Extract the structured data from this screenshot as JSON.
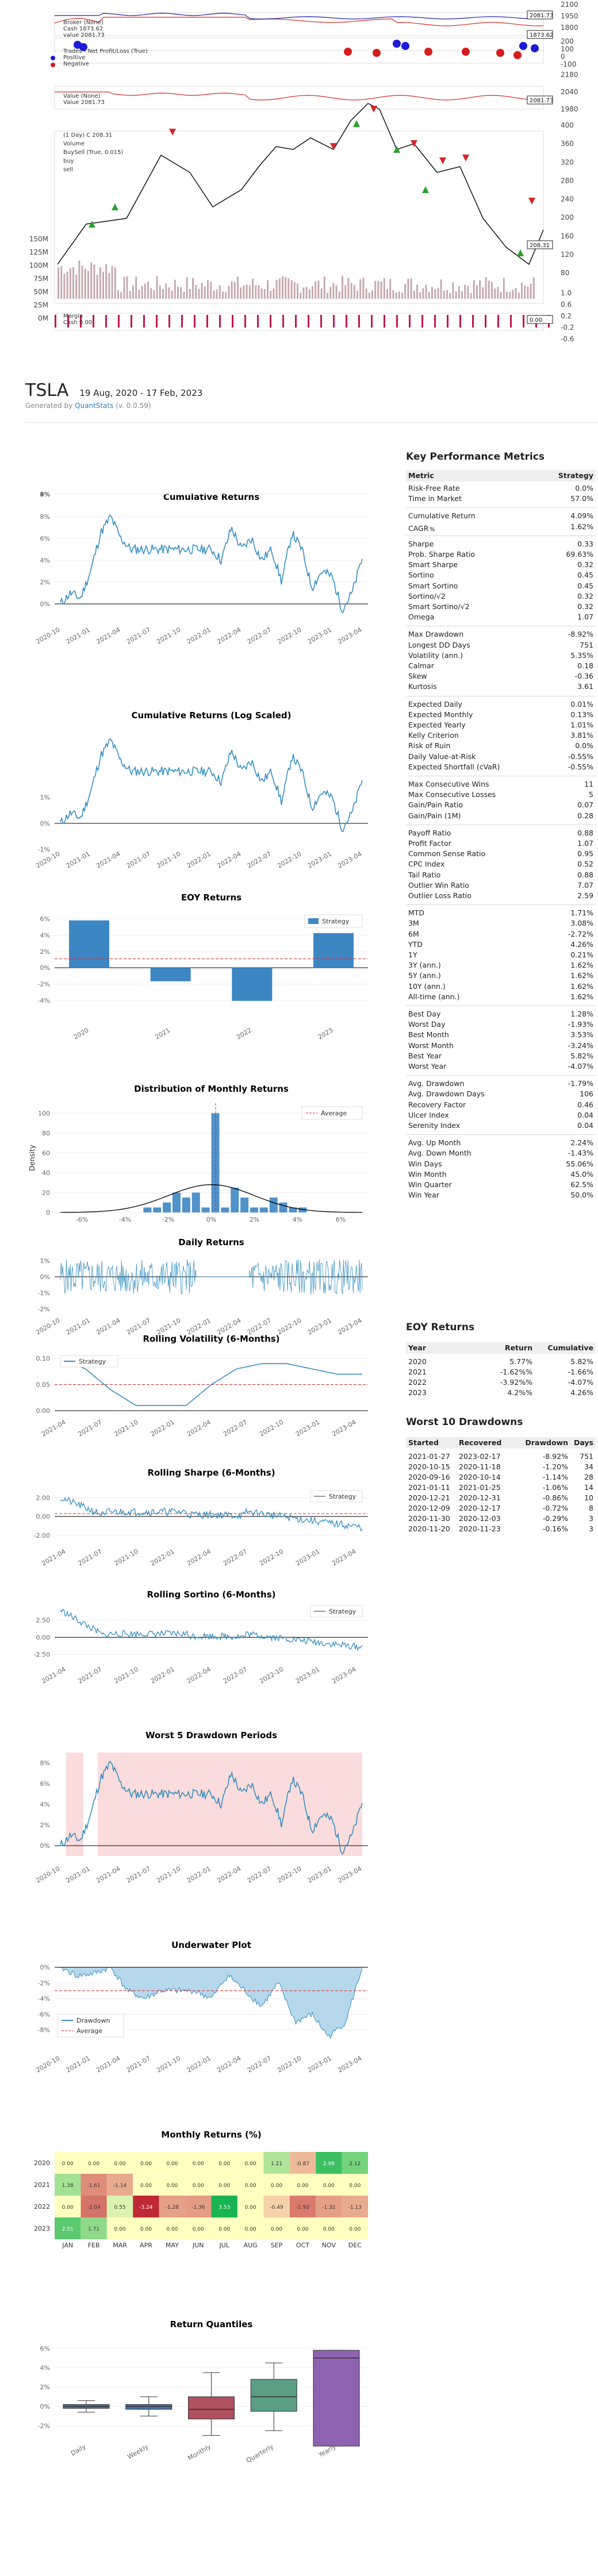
{
  "header": {
    "title": "TSLA",
    "period": "19 Aug, 2020 - 17 Feb, 2023",
    "generated_prefix": "Generated by ",
    "generated_link": "QuantStats",
    "generated_version": " (v. 0.0.59)"
  },
  "top_panel": {
    "legend_broker": [
      "Broker (None)",
      "Cash 1873.62",
      "value 2081.73"
    ],
    "legend_trades": [
      "Trades - Net Profit/Loss (True)",
      "Positive",
      "Negative"
    ],
    "legend_value": [
      "Value (None)",
      "Value 2081.73"
    ],
    "legend_price": [
      "(1 Day) C 208.31",
      "Volume",
      "BuySell (True, 0.015)",
      "buy",
      "sell"
    ],
    "legend_margin": [
      "Margin",
      "Cash 0.00"
    ],
    "badges": [
      "2081.73",
      "1873.62",
      "2081.73",
      "208.31",
      "0.00"
    ],
    "right_ticks_broker": [
      "2100",
      "1950",
      "1800"
    ],
    "right_ticks_trades": [
      "200",
      "100",
      "0",
      "-100"
    ],
    "right_ticks_value": [
      "2180",
      "2040",
      "1980"
    ],
    "right_ticks_price": [
      "400",
      "360",
      "320",
      "280",
      "240",
      "200",
      "160",
      "120",
      "80"
    ],
    "left_ticks_volume": [
      "150M",
      "125M",
      "100M",
      "75M",
      "50M",
      "25M",
      "0M"
    ],
    "right_ticks_margin": [
      "1.0",
      "0.6",
      "0.2",
      "-0.2",
      "-0.6"
    ]
  },
  "kpi": {
    "title": "Key Performance Metrics",
    "col_metric": "Metric",
    "col_strategy": "Strategy",
    "groups": [
      [
        [
          "Risk-Free Rate",
          "0.0%"
        ],
        [
          "Time in Market",
          "57.0%"
        ]
      ],
      [
        [
          "Cumulative Return",
          "4.09%"
        ],
        [
          "CAGR﹪",
          "1.62%"
        ]
      ],
      [
        [
          "Sharpe",
          "0.33"
        ],
        [
          "Prob. Sharpe Ratio",
          "69.63%"
        ],
        [
          "Smart Sharpe",
          "0.32"
        ],
        [
          "Sortino",
          "0.45"
        ],
        [
          "Smart Sortino",
          "0.45"
        ],
        [
          "Sortino/√2",
          "0.32"
        ],
        [
          "Smart Sortino/√2",
          "0.32"
        ],
        [
          "Omega",
          "1.07"
        ]
      ],
      [
        [
          "Max Drawdown",
          "-8.92%"
        ],
        [
          "Longest DD Days",
          "751"
        ],
        [
          "Volatility (ann.)",
          "5.35%"
        ],
        [
          "Calmar",
          "0.18"
        ],
        [
          "Skew",
          "-0.36"
        ],
        [
          "Kurtosis",
          "3.61"
        ]
      ],
      [
        [
          "Expected Daily",
          "0.01%"
        ],
        [
          "Expected Monthly",
          "0.13%"
        ],
        [
          "Expected Yearly",
          "1.01%"
        ],
        [
          "Kelly Criterion",
          "3.81%"
        ],
        [
          "Risk of Ruin",
          "0.0%"
        ],
        [
          "Daily Value-at-Risk",
          "-0.55%"
        ],
        [
          "Expected Shortfall (cVaR)",
          "-0.55%"
        ]
      ],
      [
        [
          "Max Consecutive Wins",
          "11"
        ],
        [
          "Max Consecutive Losses",
          "5"
        ],
        [
          "Gain/Pain Ratio",
          "0.07"
        ],
        [
          "Gain/Pain (1M)",
          "0.28"
        ]
      ],
      [
        [
          "Payoff Ratio",
          "0.88"
        ],
        [
          "Profit Factor",
          "1.07"
        ],
        [
          "Common Sense Ratio",
          "0.95"
        ],
        [
          "CPC Index",
          "0.52"
        ],
        [
          "Tail Ratio",
          "0.88"
        ],
        [
          "Outlier Win Ratio",
          "7.07"
        ],
        [
          "Outlier Loss Ratio",
          "2.59"
        ]
      ],
      [
        [
          "MTD",
          "1.71%"
        ],
        [
          "3M",
          "3.08%"
        ],
        [
          "6M",
          "-2.72%"
        ],
        [
          "YTD",
          "4.26%"
        ],
        [
          "1Y",
          "0.21%"
        ],
        [
          "3Y (ann.)",
          "1.62%"
        ],
        [
          "5Y (ann.)",
          "1.62%"
        ],
        [
          "10Y (ann.)",
          "1.62%"
        ],
        [
          "All-time (ann.)",
          "1.62%"
        ]
      ],
      [
        [
          "Best Day",
          "1.28%"
        ],
        [
          "Worst Day",
          "-1.93%"
        ],
        [
          "Best Month",
          "3.53%"
        ],
        [
          "Worst Month",
          "-3.24%"
        ],
        [
          "Best Year",
          "5.82%"
        ],
        [
          "Worst Year",
          "-4.07%"
        ]
      ],
      [
        [
          "Avg. Drawdown",
          "-1.79%"
        ],
        [
          "Avg. Drawdown Days",
          "106"
        ],
        [
          "Recovery Factor",
          "0.46"
        ],
        [
          "Ulcer Index",
          "0.04"
        ],
        [
          "Serenity Index",
          "0.04"
        ]
      ],
      [
        [
          "Avg. Up Month",
          "2.24%"
        ],
        [
          "Avg. Down Month",
          "-1.43%"
        ],
        [
          "Win Days",
          "55.06%"
        ],
        [
          "Win Month",
          "45.0%"
        ],
        [
          "Win Quarter",
          "62.5%"
        ],
        [
          "Win Year",
          "50.0%"
        ]
      ]
    ]
  },
  "eoy_table": {
    "title": "EOY Returns",
    "headers": [
      "Year",
      "Return",
      "Cumulative"
    ],
    "rows": [
      [
        "2020",
        "5.77%",
        "5.82%"
      ],
      [
        "2021",
        "-1.62%%",
        "-1.66%"
      ],
      [
        "2022",
        "-3.92%%",
        "-4.07%"
      ],
      [
        "2023",
        "4.2%%",
        "4.26%"
      ]
    ]
  },
  "dd_table": {
    "title": "Worst 10 Drawdowns",
    "headers": [
      "Started",
      "Recovered",
      "Drawdown",
      "Days"
    ],
    "rows": [
      [
        "2021-01-27",
        "2023-02-17",
        "-8.92%",
        "751"
      ],
      [
        "2020-10-15",
        "2020-11-18",
        "-1.20%",
        "34"
      ],
      [
        "2020-09-16",
        "2020-10-14",
        "-1.14%",
        "28"
      ],
      [
        "2021-01-11",
        "2021-01-25",
        "-1.06%",
        "14"
      ],
      [
        "2020-12-21",
        "2020-12-31",
        "-0.86%",
        "10"
      ],
      [
        "2020-12-09",
        "2020-12-17",
        "-0.72%",
        "8"
      ],
      [
        "2020-11-30",
        "2020-12-03",
        "-0.29%",
        "3"
      ],
      [
        "2020-11-20",
        "2020-11-23",
        "-0.16%",
        "3"
      ]
    ]
  },
  "chart_data": [
    {
      "type": "line",
      "title": "Cumulative Returns",
      "x": [
        "2020-08",
        "2020-09",
        "2020-10",
        "2020-11",
        "2020-12",
        "2021-01",
        "2021-02",
        "2021-03",
        "2021-04",
        "2021-05",
        "2021-06",
        "2021-07",
        "2021-08",
        "2021-09",
        "2021-10",
        "2021-11",
        "2021-12",
        "2022-01",
        "2022-02",
        "2022-03",
        "2022-04",
        "2022-05",
        "2022-06",
        "2022-07",
        "2022-08",
        "2022-09",
        "2022-10",
        "2022-11",
        "2022-12",
        "2023-01",
        "2023-02"
      ],
      "values": [
        0.0,
        1.0,
        0.5,
        3.0,
        6.5,
        8.0,
        6.0,
        5.0,
        5.0,
        5.0,
        5.0,
        5.0,
        5.0,
        5.0,
        5.0,
        5.0,
        4.0,
        7.0,
        5.0,
        6.0,
        4.0,
        5.0,
        2.0,
        6.5,
        5.0,
        1.5,
        3.0,
        2.5,
        -0.5,
        1.0,
        4.2
      ],
      "ylim": [
        -1,
        9
      ],
      "yticks": [
        "0%",
        "2%",
        "4%",
        "6%",
        "8%"
      ],
      "xticks": [
        "2020-10",
        "2021-01",
        "2021-04",
        "2021-07",
        "2021-10",
        "2022-01",
        "2022-04",
        "2022-07",
        "2022-10",
        "2023-01",
        "2023-04"
      ]
    },
    {
      "type": "line",
      "title": "Cumulative Returns (Log Scaled)",
      "x": [
        "2020-08",
        "2020-09",
        "2020-10",
        "2020-11",
        "2020-12",
        "2021-01",
        "2021-02",
        "2021-03",
        "2021-04",
        "2021-05",
        "2021-06",
        "2021-07",
        "2021-08",
        "2021-09",
        "2021-10",
        "2021-11",
        "2021-12",
        "2022-01",
        "2022-02",
        "2022-03",
        "2022-04",
        "2022-05",
        "2022-06",
        "2022-07",
        "2022-08",
        "2022-09",
        "2022-10",
        "2022-11",
        "2022-12",
        "2023-01",
        "2023-02"
      ],
      "values": [
        0.0,
        1.0,
        0.5,
        3.0,
        6.5,
        8.0,
        6.0,
        5.0,
        5.0,
        5.0,
        5.0,
        5.0,
        5.0,
        5.0,
        5.0,
        5.0,
        4.0,
        7.0,
        5.0,
        6.0,
        4.0,
        5.0,
        2.0,
        6.5,
        5.0,
        1.5,
        3.0,
        2.5,
        -0.5,
        1.0,
        4.2
      ],
      "ylim": [
        -1.5,
        9
      ],
      "yticks": [
        "-1%",
        "0%",
        "1%"
      ],
      "xticks": [
        "2020-10",
        "2021-01",
        "2021-04",
        "2021-07",
        "2021-10",
        "2022-01",
        "2022-04",
        "2022-07",
        "2022-10",
        "2023-01",
        "2023-04"
      ]
    },
    {
      "type": "bar",
      "title": "EOY Returns",
      "categories": [
        "2020",
        "2021",
        "2022",
        "2023"
      ],
      "values": [
        5.82,
        -1.66,
        -4.07,
        4.26
      ],
      "average": 1.1,
      "legend": "Strategy",
      "ylim": [
        -5,
        7
      ],
      "yticks": [
        "6%",
        "4%",
        "2%",
        "0%",
        "-2%",
        "-4%"
      ]
    },
    {
      "type": "bar",
      "title": "Distribution of Monthly Returns",
      "legend": "Average",
      "ylabel": "Density",
      "bins": [
        -2.1,
        -1.8,
        -1.5,
        -1.2,
        -0.9,
        -0.6,
        -0.3,
        0.0,
        0.3,
        0.6,
        0.9,
        1.2,
        1.5,
        1.8,
        2.1,
        2.4,
        2.7
      ],
      "values": [
        5,
        5,
        10,
        20,
        15,
        20,
        5,
        100,
        5,
        25,
        15,
        5,
        5,
        15,
        10,
        5,
        5
      ],
      "ylim": [
        0,
        110
      ],
      "yticks": [
        "0",
        "20",
        "40",
        "60",
        "80",
        "100"
      ],
      "xticks": [
        "-6%",
        "-4%",
        "-2%",
        "0%",
        "2%",
        "4%",
        "6%"
      ]
    },
    {
      "type": "line",
      "title": "Daily Returns",
      "ylim": [
        -2,
        1.5
      ],
      "yticks": [
        "1%",
        "0%",
        "-1%",
        "-2%"
      ],
      "xticks": [
        "2020-10",
        "2021-01",
        "2021-04",
        "2021-07",
        "2021-10",
        "2022-01",
        "2022-04",
        "2022-07",
        "2022-10",
        "2023-01",
        "2023-04"
      ]
    },
    {
      "type": "line",
      "title": "Rolling Volatility (6-Months)",
      "legend": "Strategy",
      "x": [
        "2021-02",
        "2021-04",
        "2021-06",
        "2021-08",
        "2021-10",
        "2021-12",
        "2022-02",
        "2022-04",
        "2022-06",
        "2022-08",
        "2022-10",
        "2022-12",
        "2023-02"
      ],
      "values": [
        0.1,
        0.08,
        0.04,
        0.01,
        0.01,
        0.01,
        0.05,
        0.08,
        0.09,
        0.09,
        0.08,
        0.07,
        0.07
      ],
      "average": 0.05,
      "ylim": [
        0,
        0.11
      ],
      "yticks": [
        "0.10",
        "0.05",
        "0.00"
      ],
      "xticks": [
        "2021-04",
        "2021-07",
        "2021-10",
        "2022-01",
        "2022-04",
        "2022-07",
        "2022-10",
        "2023-01",
        "2023-04"
      ]
    },
    {
      "type": "line",
      "title": "Rolling Sharpe (6-Months)",
      "legend": "Strategy",
      "ylim": [
        -2.5,
        3
      ],
      "yticks": [
        "2.00",
        "0.00",
        "-2.00"
      ],
      "xticks": [
        "2021-04",
        "2021-07",
        "2021-10",
        "2022-01",
        "2022-04",
        "2022-07",
        "2022-10",
        "2023-01",
        "2023-04"
      ]
    },
    {
      "type": "line",
      "title": "Rolling Sortino (6-Months)",
      "legend": "Strategy",
      "ylim": [
        -3,
        5
      ],
      "yticks": [
        "2.50",
        "0.00",
        "-2.50"
      ],
      "xticks": [
        "2021-04",
        "2021-07",
        "2021-10",
        "2022-01",
        "2022-04",
        "2022-07",
        "2022-10",
        "2023-01",
        "2023-04"
      ]
    },
    {
      "type": "line",
      "title": "Worst 5 Drawdown Periods",
      "x": [
        "2020-08",
        "2020-09",
        "2020-10",
        "2020-11",
        "2020-12",
        "2021-01",
        "2021-02",
        "2021-03",
        "2021-04",
        "2021-05",
        "2021-06",
        "2021-07",
        "2021-08",
        "2021-09",
        "2021-10",
        "2021-11",
        "2021-12",
        "2022-01",
        "2022-02",
        "2022-03",
        "2022-04",
        "2022-05",
        "2022-06",
        "2022-07",
        "2022-08",
        "2022-09",
        "2022-10",
        "2022-11",
        "2022-12",
        "2023-01",
        "2023-02"
      ],
      "values": [
        0.0,
        1.0,
        0.5,
        3.0,
        6.5,
        8.0,
        6.0,
        5.0,
        5.0,
        5.0,
        5.0,
        5.0,
        5.0,
        5.0,
        5.0,
        5.0,
        4.0,
        7.0,
        5.0,
        6.0,
        4.0,
        5.0,
        2.0,
        6.5,
        5.0,
        1.5,
        3.0,
        2.5,
        -0.5,
        1.0,
        4.2
      ],
      "ylim": [
        -1,
        9
      ],
      "yticks": [
        "8%",
        "6%",
        "4%",
        "2%",
        "0%"
      ],
      "xticks": [
        "2020-10",
        "2021-01",
        "2021-04",
        "2021-07",
        "2021-10",
        "2022-01",
        "2022-04",
        "2022-07",
        "2022-10",
        "2023-01",
        "2023-04"
      ]
    },
    {
      "type": "area",
      "title": "Underwater Plot",
      "legend": [
        "Drawdown",
        "Average"
      ],
      "x": [
        "2020-08",
        "2020-10",
        "2020-12",
        "2021-01",
        "2021-02",
        "2021-04",
        "2021-06",
        "2021-08",
        "2021-10",
        "2021-12",
        "2022-01",
        "2022-03",
        "2022-05",
        "2022-07",
        "2022-09",
        "2022-11",
        "2022-12",
        "2023-01",
        "2023-02"
      ],
      "values": [
        0.0,
        -1.1,
        -0.8,
        0.0,
        -3.0,
        -4.0,
        -3.0,
        -3.0,
        -3.0,
        -4.0,
        -1.0,
        -3.0,
        -5.0,
        -2.0,
        -7.0,
        -6.0,
        -8.9,
        -7.0,
        0.0
      ],
      "average": -3.0,
      "ylim": [
        -10,
        1
      ],
      "yticks": [
        "0%",
        "-2%",
        "-4%",
        "-6%",
        "-8%"
      ],
      "xticks": [
        "2020-10",
        "2021-01",
        "2021-04",
        "2021-07",
        "2021-10",
        "2022-01",
        "2022-04",
        "2022-07",
        "2022-10",
        "2023-01",
        "2023-04"
      ]
    },
    {
      "type": "heatmap",
      "title": "Monthly Returns (%)",
      "months": [
        "JAN",
        "FEB",
        "MAR",
        "APR",
        "MAY",
        "JUN",
        "JUL",
        "AUG",
        "SEP",
        "OCT",
        "NOV",
        "DEC"
      ],
      "years": [
        "2020",
        "2021",
        "2022",
        "2023"
      ],
      "values": [
        [
          0.0,
          0.0,
          0.0,
          0.0,
          0.0,
          0.0,
          0.0,
          0.0,
          1.21,
          -0.87,
          2.98,
          2.12
        ],
        [
          1.38,
          -1.61,
          -1.14,
          0.0,
          0.0,
          0.0,
          0.0,
          0.0,
          0.0,
          0.0,
          0.0,
          0.0
        ],
        [
          0.0,
          -2.04,
          0.55,
          -3.24,
          -1.28,
          -1.36,
          3.53,
          0.0,
          -0.49,
          -1.92,
          -1.32,
          -1.13
        ],
        [
          2.51,
          1.71,
          0.0,
          0.0,
          0.0,
          0.0,
          0.0,
          0.0,
          0.0,
          0.0,
          0.0,
          0.0
        ]
      ]
    },
    {
      "type": "bar",
      "title": "Return Quantiles",
      "categories": [
        "Daily",
        "Weekly",
        "Monthly",
        "Quarterly",
        "Yearly"
      ],
      "boxes": [
        {
          "min": -0.6,
          "q1": -0.2,
          "median": 0.0,
          "q3": 0.2,
          "max": 0.6,
          "color": "#4c72b0"
        },
        {
          "min": -1.0,
          "q1": -0.3,
          "median": 0.0,
          "q3": 0.2,
          "max": 1.0,
          "color": "#55a868"
        },
        {
          "min": -3.0,
          "q1": -1.3,
          "median": -0.3,
          "q3": 1.0,
          "max": 3.5,
          "color": "#c44e52"
        },
        {
          "min": -2.5,
          "q1": -0.5,
          "median": 1.0,
          "q3": 2.8,
          "max": 4.5,
          "color": "#8172b2"
        },
        {
          "min": -4.1,
          "q1": -4.1,
          "median": 5.0,
          "q3": 5.8,
          "max": 5.8,
          "color": "#8172b2"
        }
      ],
      "ylim": [
        -2.5,
        7
      ],
      "yticks": [
        "6%",
        "4%",
        "2%",
        "0%",
        "-2%"
      ]
    }
  ],
  "colors": {
    "strategy_line": "#348dc1",
    "bar": "#3d86c4",
    "average_line": "#d62728",
    "drawdown_shade": "#fbdcdc",
    "underwater_fill": "#b6d8ec",
    "accent_link": "#2d7fbd"
  }
}
